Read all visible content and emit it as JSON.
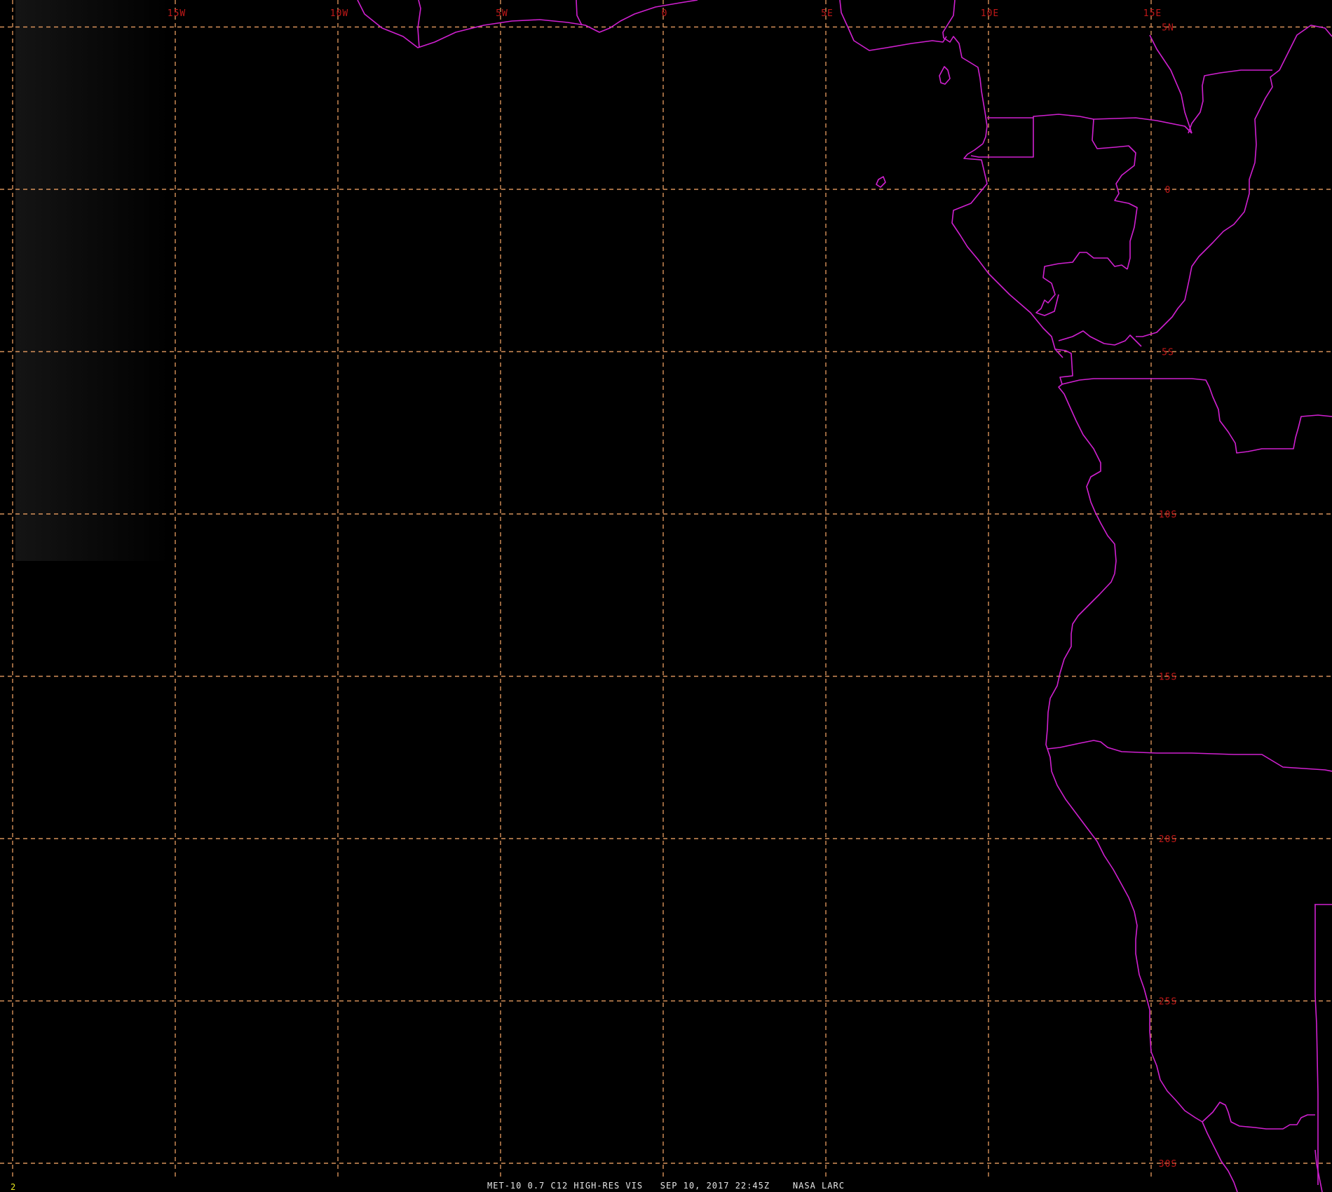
{
  "colors": {
    "background": "#000000",
    "grid": "#d8925a",
    "coastline": "#d020d0",
    "grid_label": "#c01818",
    "caption": "#e6e6e6",
    "frame_number": "#e8e820"
  },
  "map": {
    "projection": "lat-lon equirectangular",
    "lon_range": [
      -19.5,
      20
    ],
    "lat_range": [
      -31,
      5.5
    ],
    "graticule_step_deg": 5,
    "longitude_labels": [
      "15W",
      "10W",
      "5W",
      "0",
      "5E",
      "10E",
      "15E"
    ],
    "latitude_labels": [
      "5N",
      "0",
      "5S",
      "10S",
      "15S",
      "20S",
      "25S",
      "30S"
    ]
  },
  "footer": {
    "frame_number": "2",
    "caption": "MET-10 0.7 C12 HIGH-RES VIS   SEP 10, 2017 22:45Z    NASA LARC"
  }
}
